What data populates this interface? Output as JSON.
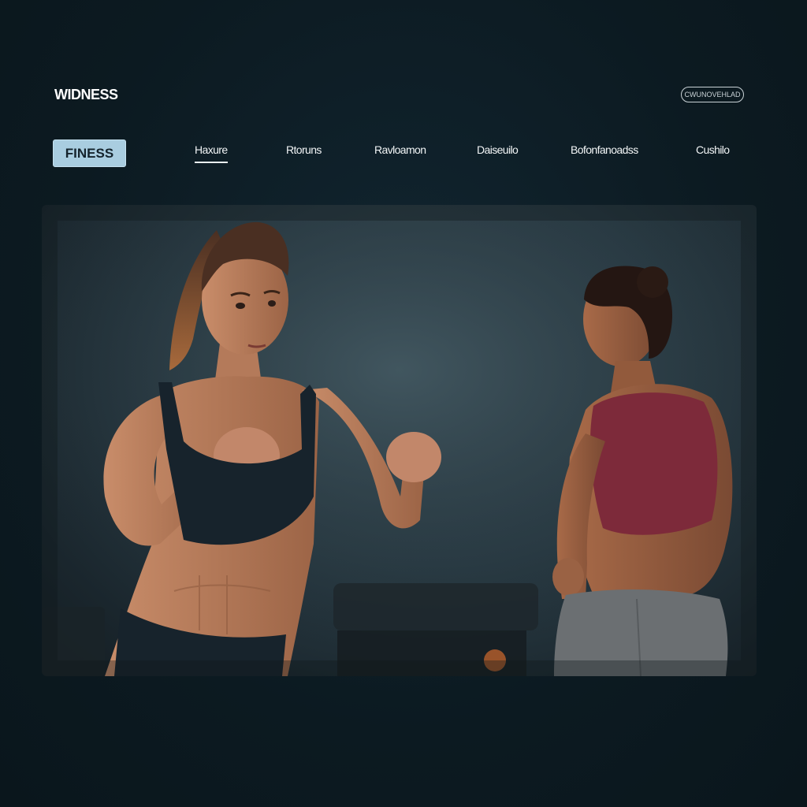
{
  "header": {
    "brand": "WIDNESS",
    "top_button": "CWUNOVEHLAD"
  },
  "logo": {
    "text": "FINESS"
  },
  "nav": {
    "items": [
      {
        "label": "Haxure",
        "active": true
      },
      {
        "label": "Rtoruns",
        "active": false
      },
      {
        "label": "Ravloamon",
        "active": false
      },
      {
        "label": "Daiseuilo",
        "active": false
      },
      {
        "label": "Bofonfanoadss",
        "active": false
      },
      {
        "label": "Cushilo",
        "active": false
      }
    ]
  },
  "hero": {
    "description": "",
    "colors": {
      "background": "#2a3c45",
      "skin": "#b47a5a",
      "left_top": "#17232c",
      "right_top": "#7d2a3a",
      "right_pants": "#6b6f72"
    }
  }
}
